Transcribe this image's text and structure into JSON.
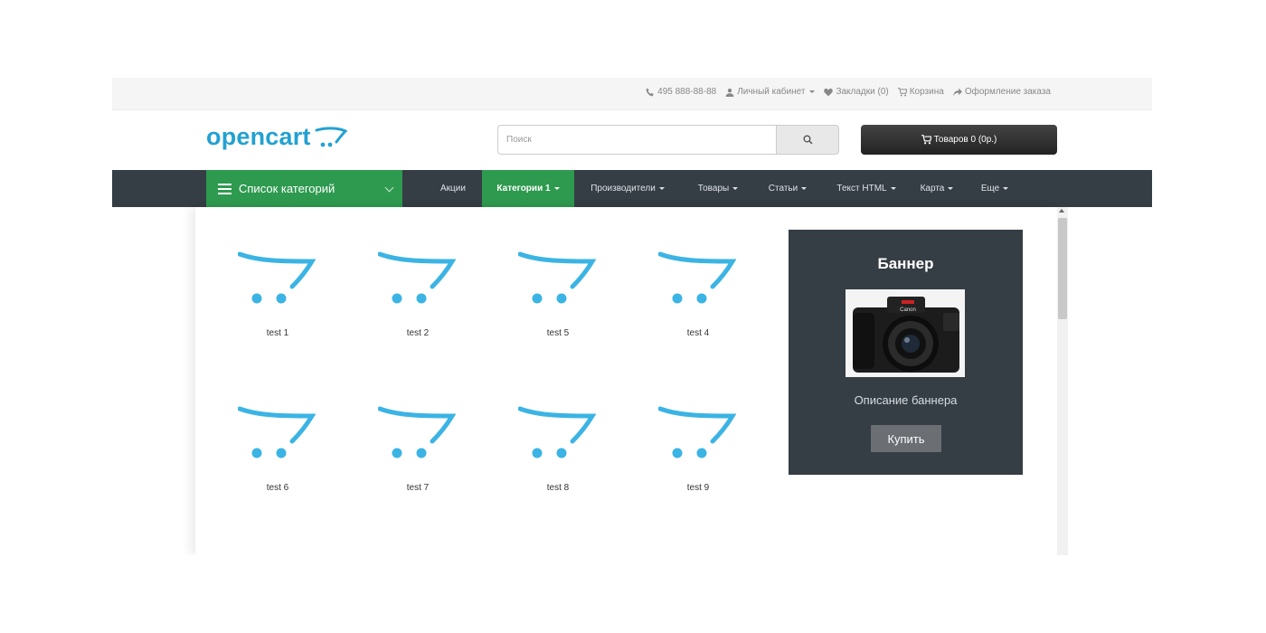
{
  "topbar": {
    "phone": "495 888-88-88",
    "account": "Личный кабинет",
    "wishlist": "Закладки (0)",
    "cart": "Корзина",
    "checkout": "Оформление заказа"
  },
  "header": {
    "logo": "opencart",
    "search_placeholder": "Поиск",
    "cart_button": "Товаров 0 (0р.)"
  },
  "nav": {
    "categories_menu": "Список категорий",
    "items": [
      {
        "label": "Акции",
        "dropdown": false
      },
      {
        "label": "Категории 1",
        "dropdown": true,
        "active": true
      },
      {
        "label": "Производители",
        "dropdown": true
      },
      {
        "label": "Товары",
        "dropdown": true
      },
      {
        "label": "Статьи",
        "dropdown": true
      },
      {
        "label": "Текст HTML",
        "dropdown": true
      },
      {
        "label": "Карта",
        "dropdown": true
      },
      {
        "label": "Еще",
        "dropdown": true
      }
    ]
  },
  "categories": [
    {
      "label": "test 1",
      "icon": "opencart-cart-icon"
    },
    {
      "label": "test 2",
      "icon": "opencart-cart-icon"
    },
    {
      "label": "test 5",
      "icon": "opencart-cart-icon"
    },
    {
      "label": "test 4",
      "icon": "opencart-cart-icon"
    },
    {
      "label": "test 6",
      "icon": "opencart-cart-icon"
    },
    {
      "label": "test 7",
      "icon": "opencart-cart-icon"
    },
    {
      "label": "test 8",
      "icon": "opencart-cart-icon"
    },
    {
      "label": "test 9",
      "icon": "opencart-cart-icon"
    }
  ],
  "banner": {
    "title": "Баннер",
    "image": "camera-image",
    "description": "Описание баннера",
    "button": "Купить"
  },
  "colors": {
    "brand_blue": "#23a1d1",
    "nav_dark": "#353d45",
    "active_green": "#2e9a4f"
  }
}
